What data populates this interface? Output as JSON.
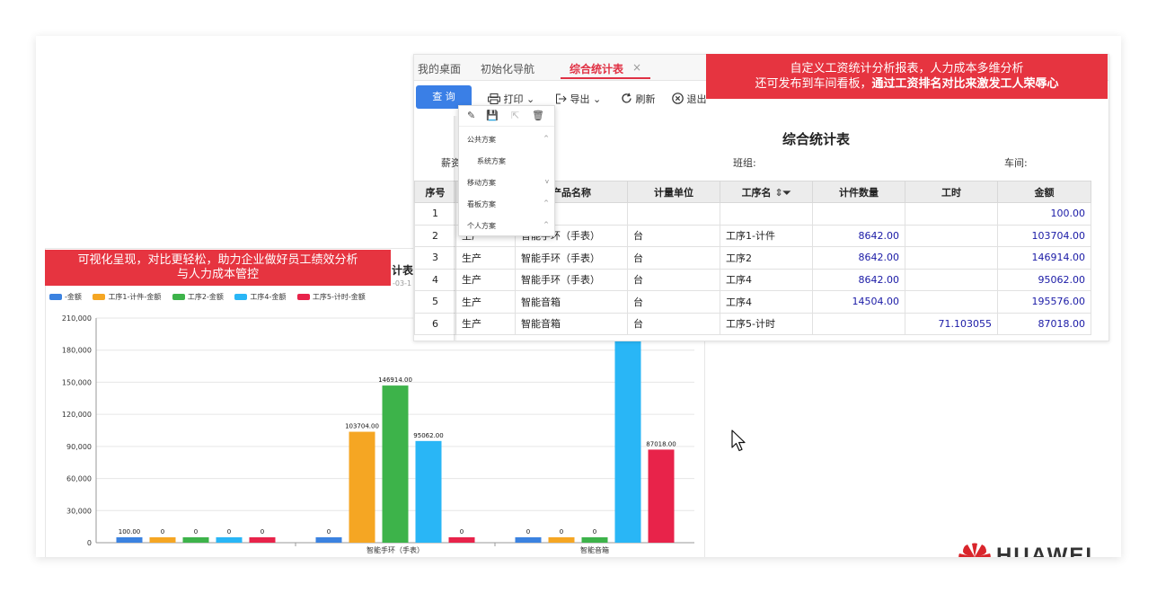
{
  "tabs": [
    "我的桌面",
    "初始化导航",
    "综合统计表"
  ],
  "tab_close": "×",
  "toolbar": {
    "query_label": "查 询",
    "print_label": "打印",
    "export_label": "导出",
    "refresh_label": "刷新",
    "exit_label": "退出"
  },
  "dropdown": {
    "sections": [
      "公共方案",
      "系统方案",
      "移动方案",
      "看板方案",
      "个人方案"
    ]
  },
  "report": {
    "title": "综合统计表",
    "meta_salary": "薪资",
    "meta_team": "班组:",
    "meta_workshop": "车间:",
    "headers": [
      "序号",
      "",
      "产品名称",
      "计量单位",
      "工序名",
      "计件数量",
      "工时",
      "金额"
    ],
    "rows": [
      [
        "1",
        "",
        "",
        "",
        "",
        "",
        "",
        "100.00"
      ],
      [
        "2",
        "生产",
        "智能手环（手表）",
        "台",
        "工序1-计件",
        "8642.00",
        "",
        "103704.00"
      ],
      [
        "3",
        "生产",
        "智能手环（手表）",
        "台",
        "工序2",
        "8642.00",
        "",
        "146914.00"
      ],
      [
        "4",
        "生产",
        "智能手环（手表）",
        "台",
        "工序4",
        "8642.00",
        "",
        "95062.00"
      ],
      [
        "5",
        "生产",
        "智能音箱",
        "台",
        "工序4",
        "14504.00",
        "",
        "195576.00"
      ],
      [
        "6",
        "生产",
        "智能音箱",
        "台",
        "工序5-计时",
        "",
        "71.103055",
        "87018.00"
      ]
    ]
  },
  "banners": {
    "top_line1": "自定义工资统计分析报表，人力成本多维分析",
    "top_line2_normal": "还可发布到车间看板，",
    "top_line2_bold": "通过工资排名对比来激发工人荣辱心",
    "left_line1": "可视化呈现，对比更轻松，助力企业做好员工绩效分析",
    "left_line2": "与人力成本管控"
  },
  "chart_frag": {
    "title_fragment": "计表",
    "date_fragment": "-03-1"
  },
  "logo_text": "HUAWEI",
  "colors": {
    "accent_red": "#e63440",
    "query_blue": "#3a7fe6",
    "value_blue": "#1a1aa6"
  },
  "chart_data": {
    "type": "bar",
    "categories": [
      "",
      "智能手环（手表）",
      "智能音箱"
    ],
    "series": [
      {
        "name": "-金额",
        "color": "#3b82e0",
        "values": [
          100,
          0,
          0
        ]
      },
      {
        "name": "工序1-计件-金额",
        "color": "#f5a623",
        "values": [
          0,
          103704,
          0
        ]
      },
      {
        "name": "工序2-金额",
        "color": "#3db34a",
        "values": [
          0,
          146914,
          0
        ]
      },
      {
        "name": "工序4-金额",
        "color": "#29b6f6",
        "values": [
          0,
          95062,
          195576
        ]
      },
      {
        "name": "工序5-计时-金额",
        "color": "#e8234a",
        "values": [
          0,
          0,
          87018
        ]
      }
    ],
    "data_labels": [
      [
        "100.00",
        "0",
        "0",
        "0",
        "0"
      ],
      [
        "0",
        "103704.00",
        "146914.00",
        "95062.00",
        "0"
      ],
      [
        "0",
        "0",
        "0",
        "",
        "87018.00"
      ]
    ],
    "yticks": [
      "0",
      "30,000",
      "60,000",
      "90,000",
      "120,000",
      "150,000",
      "180,000",
      "210,000"
    ],
    "ylim": [
      0,
      210000
    ],
    "grid": true,
    "legend_position": "top-left"
  }
}
